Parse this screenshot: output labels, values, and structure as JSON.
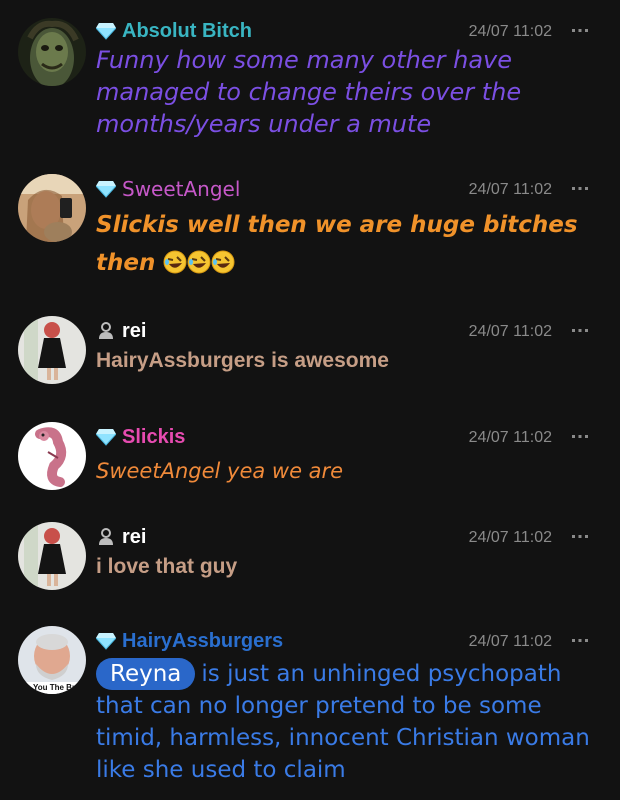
{
  "messages": [
    {
      "id": "m1",
      "username": "Absolut Bitch",
      "timestamp": "24/07 11:02",
      "badge": "diamond-icon",
      "name_color": "#39b5c2",
      "text_color": "#7b4fe3",
      "text": "Funny how some many other have managed to change theirs over the months/years under a mute"
    },
    {
      "id": "m2",
      "username": "SweetAngel",
      "timestamp": "24/07 11:02",
      "badge": "diamond-icon",
      "name_color": "#c658c8",
      "text_color": "#f0922a",
      "text": "Slickis well then we are huge bitches then",
      "emojis": [
        "rolling-on-floor-laughing-emoji",
        "rolling-on-floor-laughing-emoji",
        "rolling-on-floor-laughing-emoji"
      ]
    },
    {
      "id": "m3",
      "username": "rei",
      "timestamp": "24/07 11:02",
      "badge": "user-icon",
      "name_color": "#ffffff",
      "text_color": "#c69e86",
      "text": "HairyAssburgers is awesome"
    },
    {
      "id": "m4",
      "username": "Slickis",
      "timestamp": "24/07 11:02",
      "badge": "diamond-icon",
      "name_color": "#e64bb0",
      "text_color": "#f08a3a",
      "text": "SweetAngel yea we are"
    },
    {
      "id": "m5",
      "username": "rei",
      "timestamp": "24/07 11:02",
      "badge": "user-icon",
      "name_color": "#ffffff",
      "text_color": "#c69e86",
      "text": "i love that guy"
    },
    {
      "id": "m6",
      "username": "HairyAssburgers",
      "timestamp": "24/07 11:02",
      "badge": "diamond-icon",
      "name_color": "#2a6fcf",
      "text_color": "#3a7be6",
      "mention": "Reyna",
      "text": "is just an unhinged psychopath that can no longer pretend to be some timid, harmless, innocent Christian woman like she used to claim",
      "avatar_caption": "ce You The Bu"
    }
  ]
}
